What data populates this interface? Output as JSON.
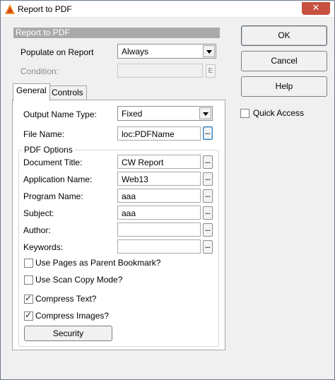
{
  "window": {
    "title": "Report to PDF",
    "close_glyph": "✕"
  },
  "section_header": "Report to PDF",
  "populate": {
    "label": "Populate on Report",
    "value": "Always"
  },
  "condition": {
    "label": "Condition:",
    "value": "",
    "edit_button": "E"
  },
  "tabs": [
    {
      "label": "General"
    },
    {
      "label": "Controls"
    }
  ],
  "general": {
    "output_name_type": {
      "label": "Output Name Type:",
      "value": "Fixed"
    },
    "file_name": {
      "label": "File Name:",
      "value": "loc:PDFName",
      "browse": "..."
    },
    "pdf_options": {
      "title": "PDF Options",
      "fields": [
        {
          "label": "Document Title:",
          "value": "CW Report",
          "browse": "..."
        },
        {
          "label": "Application Name:",
          "value": "Web13",
          "browse": "..."
        },
        {
          "label": "Program Name:",
          "value": "aaa",
          "browse": "..."
        },
        {
          "label": "Subject:",
          "value": "aaa",
          "browse": "..."
        },
        {
          "label": "Author:",
          "value": "",
          "browse": "..."
        },
        {
          "label": "Keywords:",
          "value": "",
          "browse": "..."
        }
      ],
      "checkboxes": [
        {
          "label": "Use Pages as Parent Bookmark?",
          "checked": false
        },
        {
          "label": "Use Scan Copy Mode?",
          "checked": false
        },
        {
          "label": "Compress Text?",
          "checked": true
        },
        {
          "label": "Compress Images?",
          "checked": true
        }
      ],
      "security_button": "Security"
    }
  },
  "buttons": {
    "ok": "OK",
    "cancel": "Cancel",
    "help": "Help"
  },
  "quick_access": {
    "label": "Quick Access",
    "checked": false
  },
  "check_glyph": "✓",
  "colors": {
    "title_close": "#c7503f",
    "section_header": "#a9a9a9",
    "focus": "#3c7fb1"
  }
}
